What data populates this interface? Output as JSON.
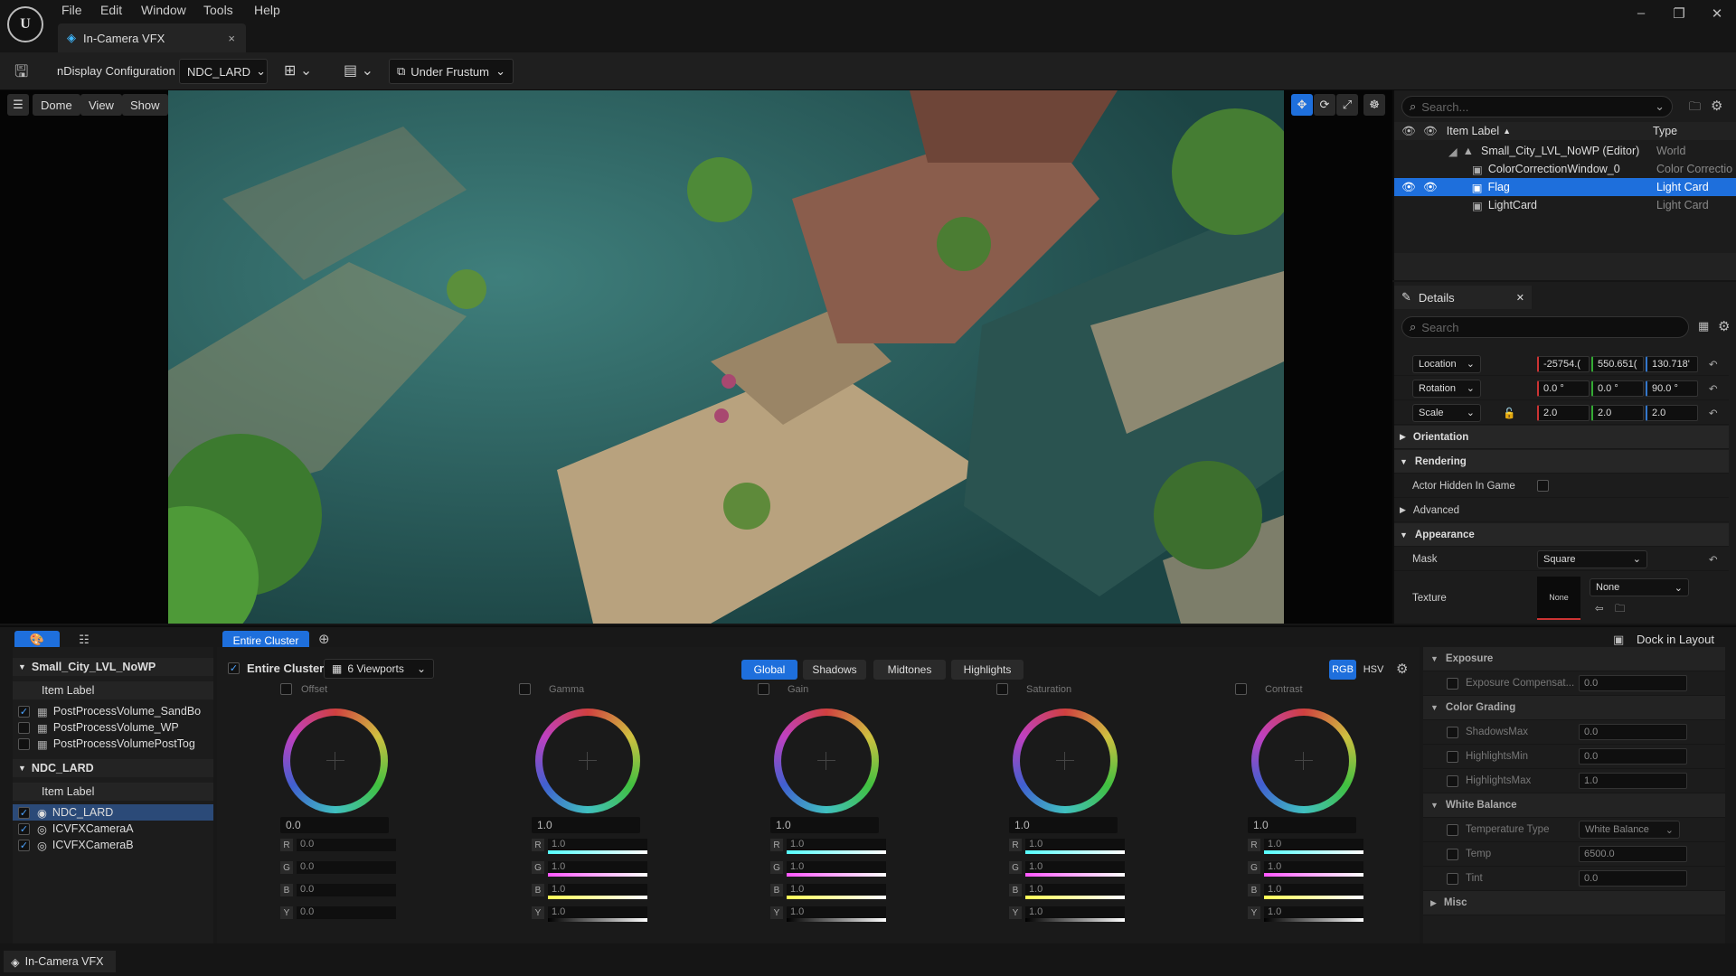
{
  "menu": [
    "File",
    "Edit",
    "Window",
    "Tools",
    "Help"
  ],
  "tab": {
    "title": "In-Camera VFX",
    "close": "×"
  },
  "window_controls": {
    "minimize": "–",
    "restore": "❐",
    "close": "✕"
  },
  "toolbar": {
    "ndisplay_label": "nDisplay Configuration",
    "config_value": "NDC_LARD",
    "frustum_value": "Under Frustum"
  },
  "viewport": {
    "buttons": [
      "Dome",
      "View",
      "Show"
    ]
  },
  "outliner": {
    "search_placeholder": "Search...",
    "col_label": "Item Label",
    "col_type": "Type",
    "rows": [
      {
        "label": "Small_City_LVL_NoWP (Editor)",
        "type": "World"
      },
      {
        "label": "ColorCorrectionWindow_0",
        "type": "Color Correctio"
      },
      {
        "label": "Flag",
        "type": "Light Card"
      },
      {
        "label": "LightCard",
        "type": "Light Card"
      }
    ]
  },
  "details": {
    "title": "Details",
    "search_placeholder": "Search",
    "location": {
      "label": "Location",
      "x": "-25754.(",
      "y": "550.651(",
      "z": "130.718'"
    },
    "rotation": {
      "label": "Rotation",
      "x": "0.0 °",
      "y": "0.0 °",
      "z": "90.0 °"
    },
    "scale": {
      "label": "Scale",
      "x": "2.0",
      "y": "2.0",
      "z": "2.0"
    },
    "sections": {
      "orientation": "Orientation",
      "rendering": "Rendering",
      "advanced": "Advanced",
      "appearance": "Appearance"
    },
    "actor_hidden": "Actor Hidden In Game",
    "mask_label": "Mask",
    "mask_value": "Square",
    "texture_label": "Texture",
    "texture_thumb": "None",
    "texture_value": "None"
  },
  "left_panel": {
    "group1": "Small_City_LVL_NoWP",
    "item_label": "Item Label",
    "group1_items": [
      "PostProcessVolume_SandBo",
      "PostProcessVolume_WP",
      "PostProcessVolumePostTog"
    ],
    "group2": "NDC_LARD",
    "group2_items": [
      "NDC_LARD",
      "ICVFXCameraA",
      "ICVFXCameraB"
    ]
  },
  "cluster": {
    "entire_cluster_btn": "Entire Cluster",
    "entire_cluster_label": "Entire Cluster",
    "viewports": "6 Viewports",
    "tabs": [
      "Global",
      "Shadows",
      "Midtones",
      "Highlights"
    ],
    "rgb": "RGB",
    "hsv": "HSV",
    "dock": "Dock in Layout",
    "wheels": [
      {
        "name": "Offset",
        "value": "0.0",
        "r": "0.0",
        "g": "0.0",
        "b": "0.0",
        "y": "0.0"
      },
      {
        "name": "Gamma",
        "value": "1.0",
        "r": "1.0",
        "g": "1.0",
        "b": "1.0",
        "y": "1.0"
      },
      {
        "name": "Gain",
        "value": "1.0",
        "r": "1.0",
        "g": "1.0",
        "b": "1.0",
        "y": "1.0"
      },
      {
        "name": "Saturation",
        "value": "1.0",
        "r": "1.0",
        "g": "1.0",
        "b": "1.0",
        "y": "1.0"
      },
      {
        "name": "Contrast",
        "value": "1.0",
        "r": "1.0",
        "g": "1.0",
        "b": "1.0",
        "y": "1.0"
      }
    ]
  },
  "right_panel": {
    "exposure": "Exposure",
    "exposure_comp": "Exposure Compensat...",
    "exposure_comp_val": "0.0",
    "color_grading": "Color Grading",
    "shadows_max": "ShadowsMax",
    "shadows_max_val": "0.0",
    "highlights_min": "HighlightsMin",
    "highlights_min_val": "0.0",
    "highlights_max": "HighlightsMax",
    "highlights_max_val": "1.0",
    "white_balance": "White Balance",
    "temp_type": "Temperature Type",
    "temp_type_val": "White Balance",
    "temp": "Temp",
    "temp_val": "6500.0",
    "tint": "Tint",
    "tint_val": "0.0",
    "misc": "Misc"
  },
  "status": {
    "tab": "In-Camera VFX"
  }
}
